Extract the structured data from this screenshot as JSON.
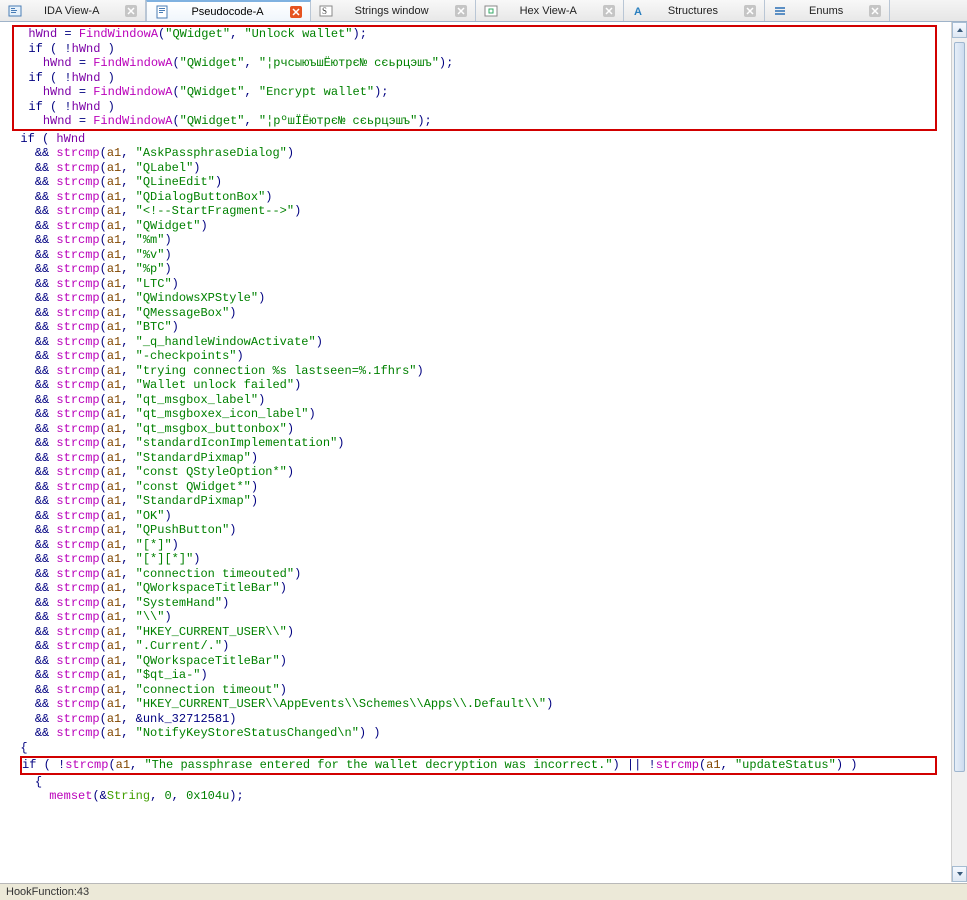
{
  "tabs": [
    {
      "label": "IDA View-A",
      "active": false,
      "close": "grey",
      "icon": "ida"
    },
    {
      "label": "Pseudocode-A",
      "active": true,
      "close": "red",
      "icon": "pseudo"
    },
    {
      "label": "Strings window",
      "active": false,
      "close": "grey",
      "icon": "strings"
    },
    {
      "label": "Hex View-A",
      "active": false,
      "close": "grey",
      "icon": "hex"
    },
    {
      "label": "Structures",
      "active": false,
      "close": "grey",
      "icon": "struct"
    },
    {
      "label": "Enums",
      "active": false,
      "close": "grey",
      "icon": "enums"
    }
  ],
  "box_top": {
    "lines": [
      {
        "indent": 2,
        "parts": [
          {
            "t": "var-purple",
            "v": "hWnd"
          },
          {
            "t": "kw",
            "v": " = "
          },
          {
            "t": "fn",
            "v": "FindWindowA"
          },
          {
            "t": "kw",
            "v": "("
          },
          {
            "t": "str",
            "v": "\"QWidget\""
          },
          {
            "t": "kw",
            "v": ", "
          },
          {
            "t": "str",
            "v": "\"Unlock wallet\""
          },
          {
            "t": "kw",
            "v": ");"
          }
        ]
      },
      {
        "indent": 2,
        "parts": [
          {
            "t": "kw",
            "v": "if ( !"
          },
          {
            "t": "var-purple",
            "v": "hWnd"
          },
          {
            "t": "kw",
            "v": " )"
          }
        ]
      },
      {
        "indent": 4,
        "parts": [
          {
            "t": "var-purple",
            "v": "hWnd"
          },
          {
            "t": "kw",
            "v": " = "
          },
          {
            "t": "fn",
            "v": "FindWindowA"
          },
          {
            "t": "kw",
            "v": "("
          },
          {
            "t": "str",
            "v": "\"QWidget\""
          },
          {
            "t": "kw",
            "v": ", "
          },
          {
            "t": "str",
            "v": "\"¦рчсыюъшЁютрє№ сєьрцэшъ\""
          },
          {
            "t": "kw",
            "v": ");"
          }
        ]
      },
      {
        "indent": 2,
        "parts": [
          {
            "t": "kw",
            "v": "if ( !"
          },
          {
            "t": "var-purple",
            "v": "hWnd"
          },
          {
            "t": "kw",
            "v": " )"
          }
        ]
      },
      {
        "indent": 4,
        "parts": [
          {
            "t": "var-purple",
            "v": "hWnd"
          },
          {
            "t": "kw",
            "v": " = "
          },
          {
            "t": "fn",
            "v": "FindWindowA"
          },
          {
            "t": "kw",
            "v": "("
          },
          {
            "t": "str",
            "v": "\"QWidget\""
          },
          {
            "t": "kw",
            "v": ", "
          },
          {
            "t": "str",
            "v": "\"Encrypt wallet\""
          },
          {
            "t": "kw",
            "v": ");"
          }
        ]
      },
      {
        "indent": 2,
        "parts": [
          {
            "t": "kw",
            "v": "if ( !"
          },
          {
            "t": "var-purple",
            "v": "hWnd"
          },
          {
            "t": "kw",
            "v": " )"
          }
        ]
      },
      {
        "indent": 4,
        "parts": [
          {
            "t": "var-purple",
            "v": "hWnd"
          },
          {
            "t": "kw",
            "v": " = "
          },
          {
            "t": "fn",
            "v": "FindWindowA"
          },
          {
            "t": "kw",
            "v": "("
          },
          {
            "t": "str",
            "v": "\"QWidget\""
          },
          {
            "t": "kw",
            "v": ", "
          },
          {
            "t": "str",
            "v": "\"¦рºшЇЁютрє№ сєьрцэшъ\""
          },
          {
            "t": "kw",
            "v": ");"
          }
        ]
      }
    ]
  },
  "mid_first": {
    "indent": 2,
    "parts": [
      {
        "t": "kw",
        "v": "if ( "
      },
      {
        "t": "var-purple",
        "v": "hWnd"
      }
    ]
  },
  "strcmp_args": [
    "\"AskPassphraseDialog\"",
    "\"QLabel\"",
    "\"QLineEdit\"",
    "\"QDialogButtonBox\"",
    "\"<!--StartFragment-->\"",
    "\"QWidget\"",
    "\"%m\"",
    "\"%v\"",
    "\"%p\"",
    "\"LTC\"",
    "\"QWindowsXPStyle\"",
    "\"QMessageBox\"",
    "\"BTC\"",
    "\"_q_handleWindowActivate\"",
    "\"-checkpoints\"",
    "\"trying connection %s lastseen=%.1fhrs\"",
    "\"Wallet unlock failed\"",
    "\"qt_msgbox_label\"",
    "\"qt_msgboxex_icon_label\"",
    "\"qt_msgbox_buttonbox\"",
    "\"standardIconImplementation\"",
    "\"StandardPixmap\"",
    "\"const QStyleOption*\"",
    "\"const QWidget*\"",
    "\"StandardPixmap\"",
    "\"OK\"",
    "\"QPushButton\"",
    "\"[*]\"",
    "\"[*][*]\"",
    "\"connection timeouted\"",
    "\"QWorkspaceTitleBar\"",
    "\"SystemHand\"",
    "\"\\\\\"",
    "\"HKEY_CURRENT_USER\\\\\"",
    "\".Current/.\"",
    "\"QWorkspaceTitleBar\"",
    "\"$qt_ia-\"",
    "\"connection timeout\"",
    "\"HKEY_CURRENT_USER\\\\AppEvents\\\\Schemes\\\\Apps\\\\.Default\\\\\""
  ],
  "strcmp_unk": "&unk_32712581",
  "strcmp_last": "\"NotifyKeyStoreStatusChanged\\n\"",
  "mid_brace": "{",
  "box_bot": {
    "parts": [
      {
        "t": "kw",
        "v": "if ( !"
      },
      {
        "t": "fn",
        "v": "strcmp"
      },
      {
        "t": "kw",
        "v": "("
      },
      {
        "t": "var-brown",
        "v": "a1"
      },
      {
        "t": "kw",
        "v": ", "
      },
      {
        "t": "str",
        "v": "\"The passphrase entered for the wallet decryption was incorrect.\""
      },
      {
        "t": "kw",
        "v": ") || !"
      },
      {
        "t": "fn",
        "v": "strcmp"
      },
      {
        "t": "kw",
        "v": "("
      },
      {
        "t": "var-brown",
        "v": "a1"
      },
      {
        "t": "kw",
        "v": ", "
      },
      {
        "t": "str",
        "v": "\"updateStatus\""
      },
      {
        "t": "kw",
        "v": ") )"
      }
    ]
  },
  "after_box": [
    {
      "indent": 4,
      "parts": [
        {
          "t": "kw",
          "v": "{"
        }
      ]
    },
    {
      "indent": 6,
      "parts": [
        {
          "t": "fn",
          "v": "memset"
        },
        {
          "t": "kw",
          "v": "(&"
        },
        {
          "t": "var-green",
          "v": "String"
        },
        {
          "t": "kw",
          "v": ", "
        },
        {
          "t": "num",
          "v": "0"
        },
        {
          "t": "kw",
          "v": ", "
        },
        {
          "t": "num",
          "v": "0x104u"
        },
        {
          "t": "kw",
          "v": ");"
        }
      ]
    }
  ],
  "status": "HookFunction:43"
}
